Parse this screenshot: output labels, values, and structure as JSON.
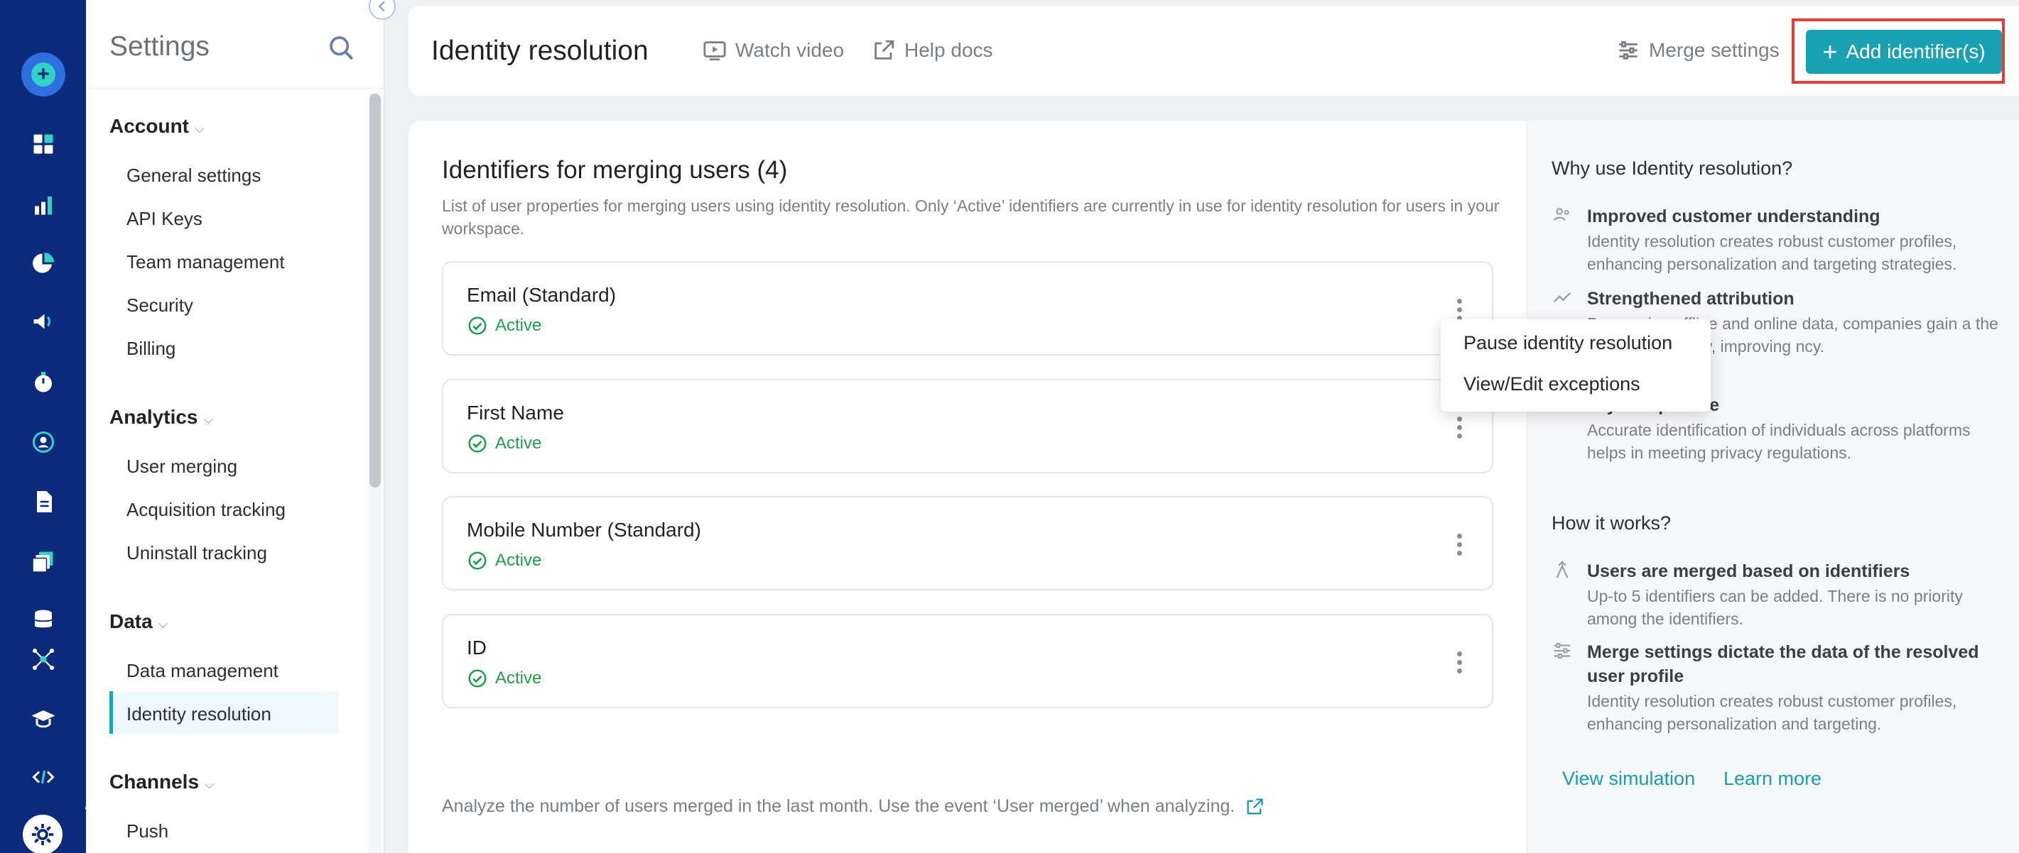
{
  "settings": {
    "title": "Settings",
    "sections": [
      {
        "label": "Account",
        "items": [
          "General settings",
          "API Keys",
          "Team management",
          "Security",
          "Billing"
        ]
      },
      {
        "label": "Analytics",
        "items": [
          "User merging",
          "Acquisition tracking",
          "Uninstall tracking"
        ]
      },
      {
        "label": "Data",
        "items": [
          "Data management",
          "Identity resolution"
        ]
      },
      {
        "label": "Channels",
        "items": [
          "Push"
        ]
      }
    ],
    "active_item": "Identity resolution"
  },
  "header": {
    "title": "Identity resolution",
    "watch_video": "Watch video",
    "help_docs": "Help docs",
    "merge_settings": "Merge settings",
    "add_identifiers": "Add identifier(s)"
  },
  "main": {
    "heading": "Identifiers for merging users (4)",
    "description": "List of user properties for merging users using identity resolution. Only ‘Active’ identifiers are currently in use for identity resolution for users in your workspace.",
    "identifiers": [
      {
        "name": "Email (Standard)",
        "status": "Active"
      },
      {
        "name": "First Name",
        "status": "Active"
      },
      {
        "name": "Mobile Number (Standard)",
        "status": "Active"
      },
      {
        "name": "ID",
        "status": "Active"
      }
    ],
    "footer_note": "Analyze the number of users merged in the last month. Use the event ‘User merged’ when analyzing."
  },
  "context_menu": {
    "items": [
      "Pause identity resolution",
      "View/Edit exceptions"
    ]
  },
  "info": {
    "why_heading": "Why use Identity resolution?",
    "why_items": [
      {
        "title": "Improved customer understanding",
        "text": "Identity resolution creates robust customer profiles, enhancing personalization and targeting strategies."
      },
      {
        "title": "Strengthened attribution",
        "text": "By merging offline and online data, companies gain a the purchase journey, improving ncy."
      },
      {
        "title": "acy compliance",
        "text": "Accurate identification of individuals across platforms helps in meeting privacy regulations."
      }
    ],
    "how_heading": "How it works?",
    "how_items": [
      {
        "title": "Users are merged based on identifiers",
        "text": "Up-to 5 identifiers can be added. There is no priority among the identifiers."
      },
      {
        "title": "Merge settings dictate the data of the resolved user profile",
        "text": "Identity resolution creates robust customer profiles, enhancing personalization and targeting."
      }
    ],
    "view_simulation": "View simulation",
    "learn_more": "Learn more"
  },
  "colors": {
    "rail": "#0c2a7c",
    "accent": "#1aa2b3",
    "active_green": "#1e9e4b",
    "highlight": "#e23b3b"
  }
}
